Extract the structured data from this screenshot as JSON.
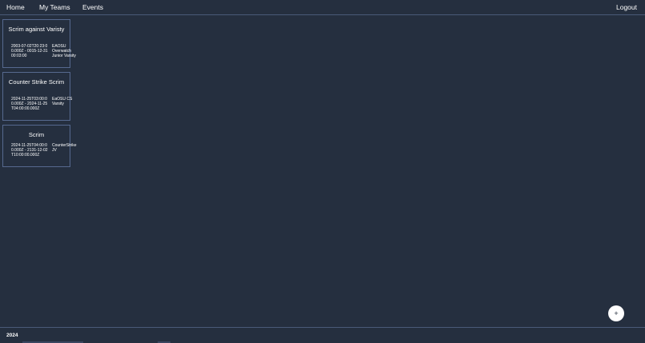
{
  "nav": {
    "home": "Home",
    "my_teams": "My Teams",
    "events": "Events",
    "logout": "Logout"
  },
  "events": [
    {
      "title": "Scrim against Varisty",
      "date_range": "2003-07-02T20:23:00.000Z - 0015-12-31 00:03:00",
      "team": "EAOSU Overwatch Junior Varsity"
    },
    {
      "title": "Counter Strike Scrim",
      "date_range": "2024-11-25T03:00:00.000Z - 2024-11-25T04:00:00.000Z",
      "team": "EaOSU CS Varsity"
    },
    {
      "title": "Scrim",
      "date_range": "2024-11-25T04:00:00.000Z - 2131-12-02T10:00:00.000Z",
      "team": "CounterStrike JV"
    }
  ],
  "fab": {
    "label": "+"
  },
  "footer": {
    "year": "2024"
  }
}
